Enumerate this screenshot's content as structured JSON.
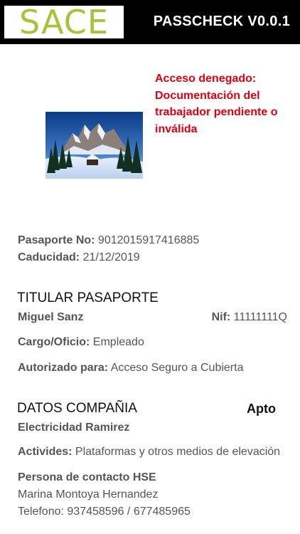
{
  "header": {
    "logo_text": "SACE",
    "title": "PASSCHECK V0.0.1",
    "background": "#000000",
    "logo_color": "#a6c33a"
  },
  "status": {
    "line1": "Acceso denegado:",
    "line2": "Documentación del",
    "line3": "trabajador pendiente o",
    "line4": "inválida",
    "color": "#e0000f"
  },
  "photo": {
    "icon": "winter-mountain-landscape-photo"
  },
  "passport": {
    "number_label": "Pasaporte No:",
    "number_value": "9012015917416885",
    "expiry_label": "Caducidad:",
    "expiry_value": "21/12/2019"
  },
  "holder": {
    "heading": "TITULAR PASAPORTE",
    "name": "Miguel Sanz",
    "nif_label": "Nif:",
    "nif_value": "11111111Q",
    "role_label": "Cargo/Oficio:",
    "role_value": "Empleado",
    "authorized_label": "Autorizado para:",
    "authorized_value": "Acceso Seguro a Cubierta"
  },
  "company": {
    "heading": "DATOS COMPAÑIA",
    "status": "Apto",
    "name": "Electricidad Ramirez",
    "activities_label": "Activides:",
    "activities_value": "Plataformas y otros medios de elevación",
    "contact_label": "Persona de contacto HSE",
    "contact_name": "Marina Montoya Hernandez",
    "phone_label": "Telefono:",
    "phone_value": "937458596 / 677485965"
  }
}
